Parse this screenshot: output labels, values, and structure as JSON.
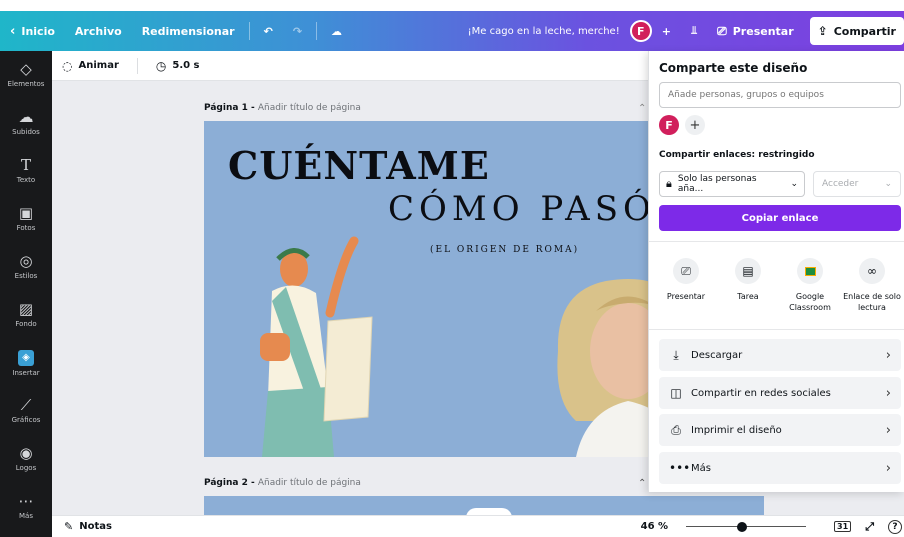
{
  "topbar": {
    "back_label": "Inicio",
    "file_label": "Archivo",
    "resize_label": "Redimensionar",
    "design_title": "¡Me cago en la leche, merche!",
    "avatar_letter": "F",
    "present_label": "Presentar",
    "share_label": "Compartir"
  },
  "sidebar": {
    "items": [
      {
        "label": "Elementos",
        "icon": "elements-icon"
      },
      {
        "label": "Subidos",
        "icon": "uploads-icon"
      },
      {
        "label": "Texto",
        "icon": "text-icon"
      },
      {
        "label": "Fotos",
        "icon": "photos-icon"
      },
      {
        "label": "Estilos",
        "icon": "styles-icon"
      },
      {
        "label": "Fondo",
        "icon": "background-icon"
      },
      {
        "label": "Insertar",
        "icon": "insert-icon"
      },
      {
        "label": "Gráficos",
        "icon": "charts-icon"
      },
      {
        "label": "Logos",
        "icon": "logos-icon"
      },
      {
        "label": "Más",
        "icon": "more-icon"
      }
    ]
  },
  "toolbar": {
    "animate_label": "Animar",
    "duration_label": "5.0 s"
  },
  "canvas": {
    "page1_prefix": "Página 1 - ",
    "page1_hint": "Añadir título de página",
    "page2_prefix": "Página 2 - ",
    "page2_hint": "Añadir título de página",
    "slide_title_1": "CUÉNTAME",
    "slide_title_2": "CÓMO PASÓ",
    "slide_subtitle": "(EL ORIGEN DE ROMA)"
  },
  "bottombar": {
    "notes_label": "Notas",
    "zoom": "46 %",
    "zoom_fraction": 0.46,
    "page_count": "31"
  },
  "share_panel": {
    "title": "Comparte este diseño",
    "input_placeholder": "Añade personas, grupos o equipos",
    "avatar_letter": "F",
    "links_label": "Compartir enlaces: restringido",
    "access_select": "Solo las personas aña...",
    "access_level": "Acceder",
    "copy_link": "Copiar enlace",
    "options": [
      {
        "label": "Presentar",
        "icon": "present-icon"
      },
      {
        "label": "Tarea",
        "icon": "task-icon"
      },
      {
        "label": "Google Classroom",
        "icon": "google-classroom-icon"
      },
      {
        "label": "Enlace de solo lectura",
        "icon": "link-icon"
      }
    ],
    "rows": [
      {
        "label": "Descargar",
        "icon": "download-icon"
      },
      {
        "label": "Compartir en redes sociales",
        "icon": "social-icon"
      },
      {
        "label": "Imprimir el diseño",
        "icon": "print-icon"
      },
      {
        "label": "Más",
        "icon": "more-dots-icon"
      }
    ]
  },
  "colors": {
    "accent": "#7d2ae8",
    "slide_bg": "#8caed6",
    "avatar": "#d11f5c"
  }
}
